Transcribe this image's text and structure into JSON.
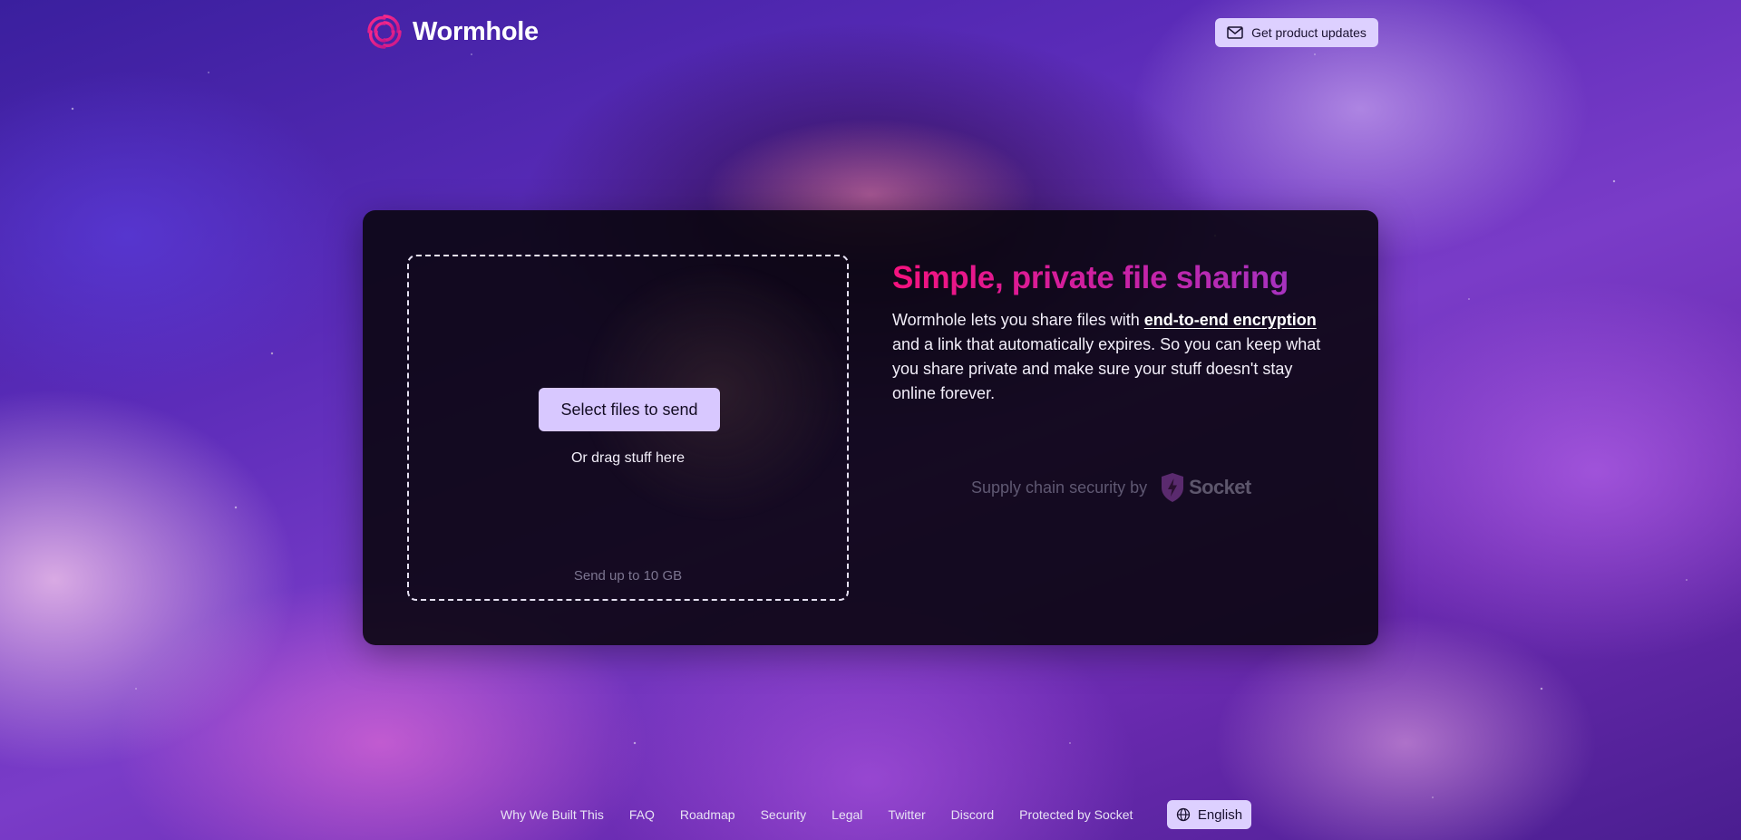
{
  "header": {
    "brand_name": "Wormhole",
    "updates_button": "Get product updates",
    "updates_icon": "mail-icon"
  },
  "upload": {
    "select_button": "Select files to send",
    "drag_hint": "Or drag stuff here",
    "limit": "Send up to 10 GB"
  },
  "info": {
    "headline": "Simple, private file sharing",
    "desc_part1": "Wormhole lets you share files with ",
    "desc_link": "end-to-end encryption",
    "desc_part2": " and a link that automatically expires. So you can keep what you share private and make sure your stuff doesn't stay online forever.",
    "supply_label": "Supply chain security by",
    "socket_name": "Socket"
  },
  "footer": {
    "links": [
      "Why We Built This",
      "FAQ",
      "Roadmap",
      "Security",
      "Legal",
      "Twitter",
      "Discord",
      "Protected by Socket"
    ],
    "language": "English",
    "language_icon": "globe-icon"
  },
  "colors": {
    "accent_button": "#d8c8ff",
    "headline_gradient_start": "#f5127e",
    "headline_gradient_end": "#9a38c8",
    "card_background": "#0a0610"
  }
}
